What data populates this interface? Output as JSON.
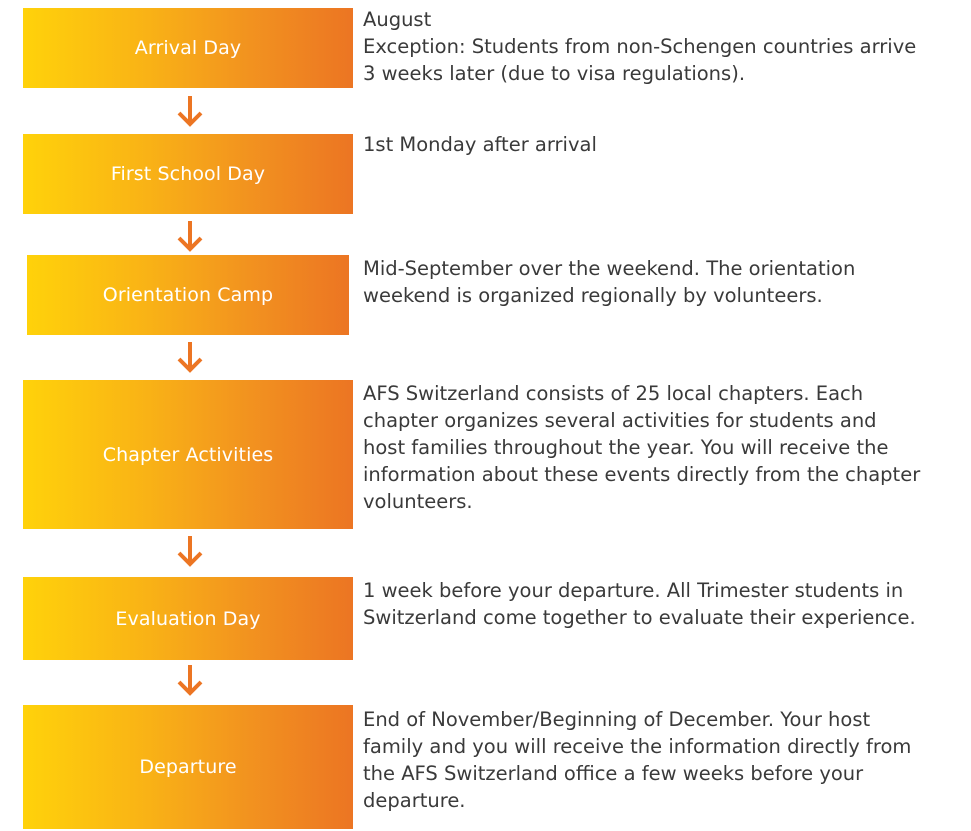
{
  "colors": {
    "gradient_start": "#ffd20a",
    "gradient_end": "#ec7523",
    "arrow": "#ec7523",
    "box_text": "#ffffff",
    "body_text": "#3a3a3a"
  },
  "steps": [
    {
      "label": "Arrival Day",
      "description": "August\nException: Students from non-Schengen countries arrive\n3 weeks later (due to visa regulations)."
    },
    {
      "label": "First School Day",
      "description": "1st Monday after arrival"
    },
    {
      "label": "Orientation Camp",
      "description": "Mid-September over the weekend. The orientation\nweekend is organized regionally by volunteers."
    },
    {
      "label": "Chapter Activities",
      "description": "AFS Switzerland consists of 25 local chapters. Each\nchapter organizes several activities for students and\nhost families throughout the year. You will receive the\ninformation about these events directly from the chapter\nvolunteers."
    },
    {
      "label": "Evaluation Day",
      "description": "1 week before your departure. All Trimester students in\nSwitzerland come together to evaluate their experience."
    },
    {
      "label": "Departure",
      "description": "End of November/Beginning of December. Your host\nfamily and you will receive the information directly from\nthe AFS Switzerland office a few weeks before your\ndeparture."
    }
  ]
}
